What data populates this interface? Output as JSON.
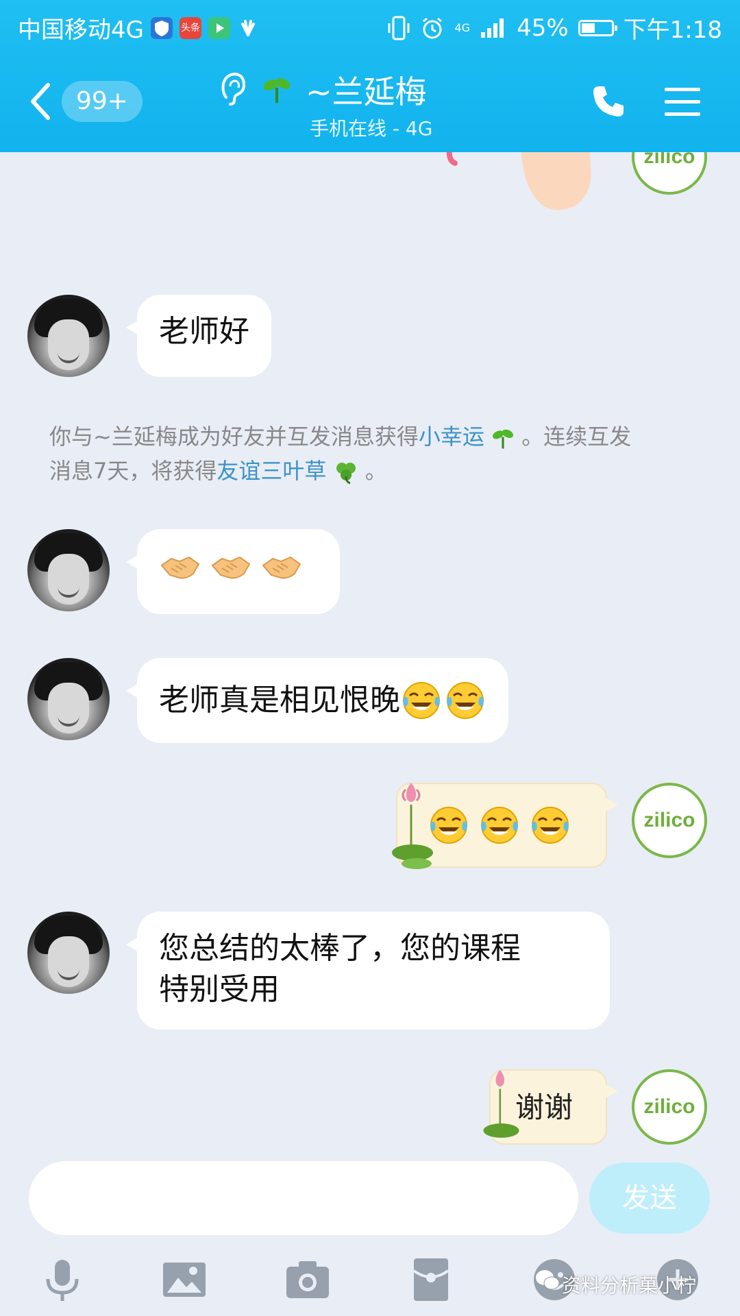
{
  "status_bar": {
    "carrier": "中国移动4G",
    "app_badge": "头条",
    "network": "4G",
    "battery": "45%",
    "battery_level": 0.45,
    "time": "下午1:18"
  },
  "header": {
    "back_badge": "99+",
    "contact_name": "~兰延梅",
    "contact_status": "手机在线 - 4G"
  },
  "messages": [
    {
      "id": "m1",
      "side": "received",
      "text": "老师好"
    },
    {
      "id": "m2",
      "side": "received",
      "emoji": [
        "handshake",
        "handshake",
        "handshake"
      ]
    },
    {
      "id": "m3",
      "side": "received",
      "text": "老师真是相见恨晚",
      "emoji": [
        "tears-of-joy",
        "tears-of-joy"
      ]
    },
    {
      "id": "m4",
      "side": "sent",
      "emoji": [
        "tears-of-joy",
        "tears-of-joy",
        "tears-of-joy"
      ]
    },
    {
      "id": "m5",
      "side": "received",
      "text_line1": "您总结的太棒了，您的课程",
      "text_line2": "特别受用"
    },
    {
      "id": "m6",
      "side": "sent",
      "text": "谢谢"
    }
  ],
  "system_message": {
    "part1": "你与~兰延梅成为好友并互发消息获得",
    "link1": "小幸运",
    "part2": "。连续互发",
    "part3": "消息7天，将获得",
    "link2": "友谊三叶草",
    "part4": "。"
  },
  "my_avatar_text": "zilico",
  "input": {
    "placeholder": "",
    "send_label": "发送"
  },
  "toolbar": [
    "microphone-icon",
    "image-icon",
    "camera-icon",
    "red-packet-icon",
    "emoji-icon",
    "plus-icon"
  ],
  "watermark": "资料分析菓小柠",
  "colors": {
    "header": "#12b3ee",
    "link": "#3a93c9",
    "sent_bubble": "#fcf3dc",
    "send_button": "#bfeefb"
  }
}
